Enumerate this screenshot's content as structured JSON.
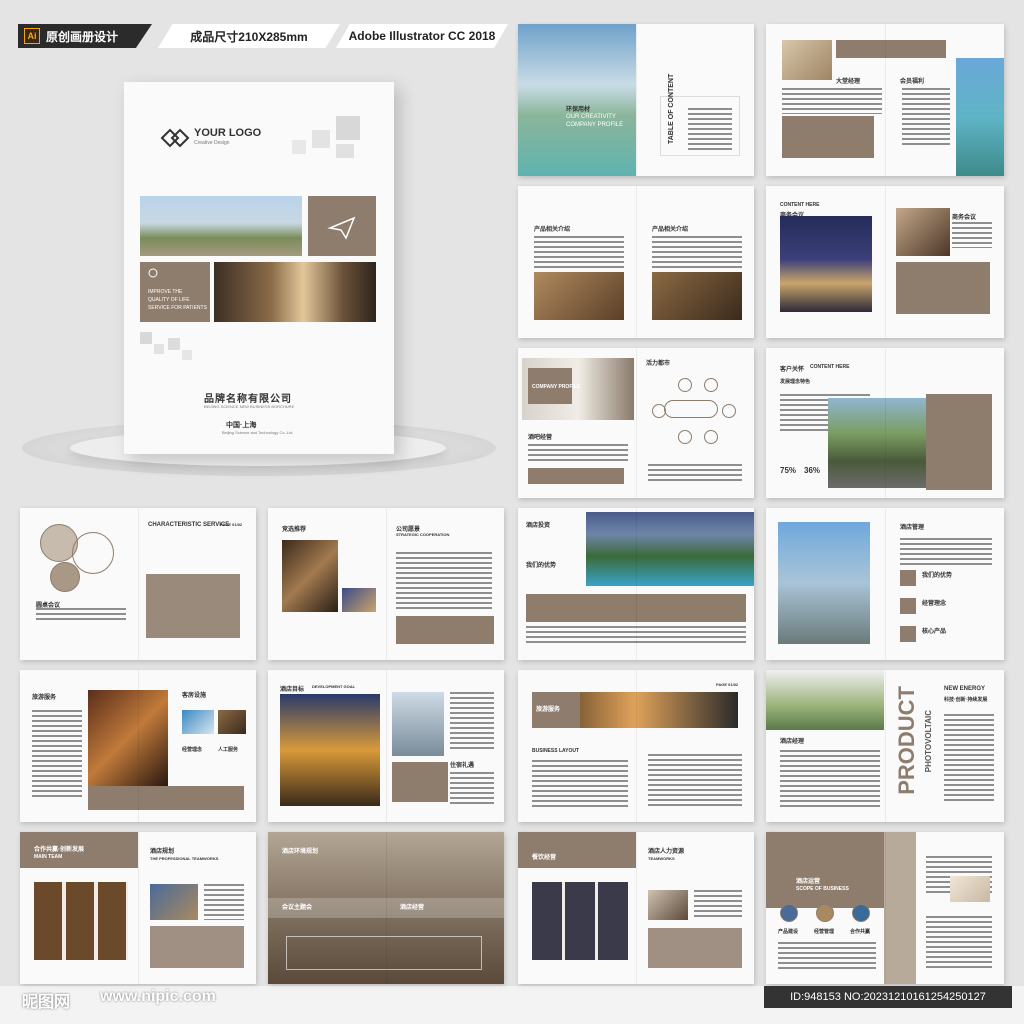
{
  "header": {
    "ai_badge": "Ai",
    "category": "原创画册设计",
    "size": "成品尺寸210X285mm",
    "software": "Adobe Illustrator CC 2018"
  },
  "cover": {
    "logo_title": "YOUR LOGO",
    "logo_sub": "Creative Design",
    "caption": [
      "IMPROVE THE",
      "QUALITY OF LIFE",
      "SERVICE FOR PATIENTS"
    ],
    "company_cn": "品牌名称有限公司",
    "company_en": "BEIJING SCIENCE NEW BUSINESS BORCHURE",
    "city": "中国·上海",
    "city_sub": "Beijing Science and Technology Co.,Ltd"
  },
  "spreads": {
    "s1": {
      "title": "环保用材",
      "sub": [
        "OUR CREATIVITY",
        "COMPANY PROFILE"
      ],
      "toc": "TABLE OF CONTENT"
    },
    "s2": {
      "left": "大堂经理",
      "right": "会员福利",
      "tag": "CONTENT HERE"
    },
    "s3": {
      "a": "产品相关介绍",
      "b": "产品相关介绍"
    },
    "s4": {
      "title": "商务会议",
      "tag": "CONTENT HERE",
      "right": "商务会议"
    },
    "s5": {
      "tag": "COMPANY PROFILE",
      "title": "酒吧经营",
      "right": "活力都市"
    },
    "s6": {
      "title": "客户关怀",
      "tag": "CONTENT HERE",
      "sub": "发展理念特色",
      "pct1": "75%",
      "pct2": "36%"
    },
    "s7": {
      "title": "圆桌会议",
      "right": "CHARACTERISTIC SERVICE",
      "page": "PAGE 01/02"
    },
    "s8": {
      "left": "竞选推荐",
      "right": "公司愿景",
      "sub": "STRATEGIC COOPERATION"
    },
    "s9": {
      "title": "酒店投资",
      "sub": "我们的优势"
    },
    "s10": {
      "title": "酒店管理",
      "items": [
        "我们的优势",
        "经营理念",
        "核心产品"
      ]
    },
    "s11": {
      "left": "旅游服务",
      "right": "客房设施",
      "items": [
        "经营理念",
        "人工服务"
      ]
    },
    "s12": {
      "title": "酒店目标",
      "tag": "DEVELOPMENT GOAL",
      "right": "住宿礼遇"
    },
    "s13": {
      "title": "旅游服务",
      "sub": "BUSINESS LAYOUT",
      "page": "PAGE 01/02"
    },
    "s14": {
      "title": "酒店经理",
      "big": "PRODUCT",
      "big2": "PHOTOVOLTAIC",
      "right": "NEW ENERGY",
      "right_cn": "科技·创新·持续发展"
    },
    "s15": {
      "title": "合作共赢·创新发展",
      "tag": "MAIN TEAM",
      "right": "酒店规划",
      "right_tag": "THE PROFESSIONAL TEAMWORKS"
    },
    "s16": {
      "title": "酒店环境规划",
      "left": "会议主题会",
      "right": "酒店经营"
    },
    "s17": {
      "title": "餐饮经营",
      "right": "酒店人力资源",
      "tag": "TEAMWORKS"
    },
    "s18": {
      "title": "酒店运营",
      "tag": "SCOPE OF BUSINESS",
      "items": [
        "产品建设",
        "经营管理",
        "合作共赢"
      ]
    }
  },
  "footer": {
    "site": "昵图网",
    "url": "www.nipic.com",
    "id": "ID:948153 NO:20231210161254250127"
  },
  "colors": {
    "accent": "#8e7d6d",
    "background": "#e4e4e4",
    "page": "#fafafa"
  }
}
